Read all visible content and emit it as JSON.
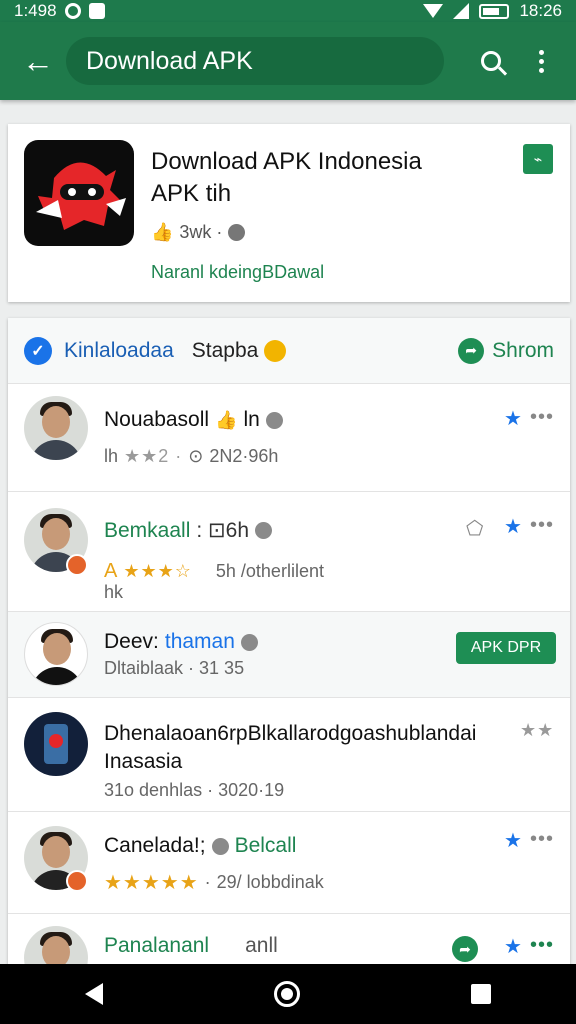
{
  "status_bar": {
    "time_left": "1:498",
    "time_right": "18:26"
  },
  "app_bar": {
    "search_text": "Download APK",
    "back_icon": "arrow-back-icon",
    "search_icon": "search-icon",
    "menu_icon": "more-vert-icon"
  },
  "app_card": {
    "title_line1": "Download APK Indonesia",
    "title_line2": "APK tih",
    "meta_text": "3wk ·",
    "developer": "Naranl kdeingBDawal"
  },
  "feed_header": {
    "label": "Kinlaloadaa",
    "sub": "Stapba",
    "action": "Shrom"
  },
  "reviews": [
    {
      "name": "Nouabasoll",
      "suffix": "ln",
      "meta": "lh",
      "stars": "★★2 ·",
      "time": "2N2·96h"
    },
    {
      "name": "Bemkaall",
      "suffix": ": ⊡6h",
      "meta_prefix": "A",
      "stars": "★★★☆",
      "time": "5h /otherlilent",
      "extra": "hk"
    },
    {
      "name": "Deev:",
      "name_accent": "thaman",
      "meta": "Dltaiblaak · 31 35",
      "button": "APK DPR"
    },
    {
      "title_line1": "Dhenalaoan6rpBlkallarodgoashublandai",
      "title_line2": "Inasasia",
      "meta": "31o denhlas · 3020·19"
    },
    {
      "name": "Canelada!;",
      "name_accent": "Belcall",
      "stars": "★★★★★",
      "time": "29/ lobbdinak"
    },
    {
      "name": "Panalananl",
      "suffix": "anll"
    }
  ]
}
